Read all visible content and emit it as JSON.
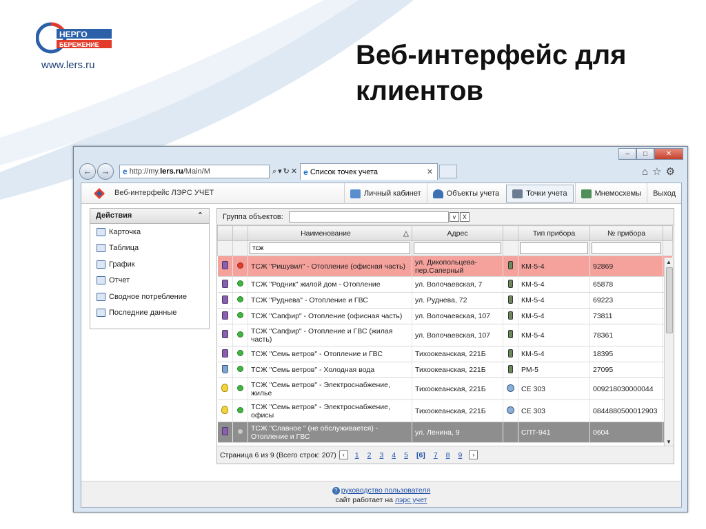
{
  "slide": {
    "title": "Веб-интерфейс для клиентов",
    "site_url": "www.lers.ru",
    "logo_text_top": "НЕРГО",
    "logo_text_bottom": "БЕРЕЖЕНИЕ"
  },
  "browser": {
    "address_prefix": "http://my.",
    "address_domain": "lers.ru",
    "address_suffix": "/Main/M",
    "tab_title": "Список точек учета"
  },
  "app": {
    "title": "Веб-интерфейс ЛЭРС УЧЕТ",
    "nav": [
      {
        "label": "Личный кабинет",
        "icon": "personal-cabinet-icon"
      },
      {
        "label": "Объекты учета",
        "icon": "objects-icon"
      },
      {
        "label": "Точки учета",
        "icon": "metering-points-icon",
        "active": true
      },
      {
        "label": "Мнемосхемы",
        "icon": "mnemonic-icon"
      },
      {
        "label": "Выход"
      }
    ]
  },
  "actions": {
    "header": "Действия",
    "items": [
      {
        "label": "Карточка",
        "icon": "card-icon"
      },
      {
        "label": "Таблица",
        "icon": "table-icon"
      },
      {
        "label": "График",
        "icon": "chart-icon"
      },
      {
        "label": "Отчет",
        "icon": "report-icon"
      },
      {
        "label": "Сводное потребление",
        "icon": "summary-icon"
      },
      {
        "label": "Последние данные",
        "icon": "latest-data-icon"
      }
    ]
  },
  "grid": {
    "group_label": "Группа объектов:",
    "columns": {
      "name": "Наименование",
      "address": "Адрес",
      "device_type": "Тип прибора",
      "device_number": "№ прибора"
    },
    "filter_name": "тсж",
    "rows": [
      {
        "name": "ТСЖ \"Ришувил\" - Отопление (офисная часть)",
        "address": "ул. Дикопольцева-пер.Саперный",
        "type": "КМ-5-4",
        "number": "92869",
        "kind": "heat",
        "status": "red",
        "device": "meter",
        "state": "alert"
      },
      {
        "name": "ТСЖ \"Родник\" жилой дом - Отопление",
        "address": "ул. Волочаевская, 7",
        "type": "КМ-5-4",
        "number": "65878",
        "kind": "heat",
        "status": "green",
        "device": "meter",
        "state": "normal"
      },
      {
        "name": "ТСЖ \"Руднева\" - Отопление и ГВС",
        "address": "ул. Руднева, 72",
        "type": "КМ-5-4",
        "number": "69223",
        "kind": "heat",
        "status": "green",
        "device": "meter",
        "state": "normal"
      },
      {
        "name": "ТСЖ \"Сапфир\" - Отопление (офисная часть)",
        "address": "ул. Волочаевская, 107",
        "type": "КМ-5-4",
        "number": "73811",
        "kind": "heat",
        "status": "green",
        "device": "meter",
        "state": "normal"
      },
      {
        "name": "ТСЖ \"Сапфир\" - Отопление и ГВС (жилая часть)",
        "address": "ул. Волочаевская, 107",
        "type": "КМ-5-4",
        "number": "78361",
        "kind": "heat",
        "status": "green",
        "device": "meter",
        "state": "normal"
      },
      {
        "name": "ТСЖ \"Семь ветров\" - Отопление и ГВС",
        "address": "Тихоокеанская, 221Б",
        "type": "КМ-5-4",
        "number": "18395",
        "kind": "heat",
        "status": "green",
        "device": "meter",
        "state": "normal"
      },
      {
        "name": "ТСЖ \"Семь ветров\" - Холодная вода",
        "address": "Тихоокеанская, 221Б",
        "type": "РМ-5",
        "number": "27095",
        "kind": "water",
        "status": "green",
        "device": "meter",
        "state": "normal"
      },
      {
        "name": "ТСЖ \"Семь ветров\" - Электроснабжение, жилье",
        "address": "Тихоокеанская, 221Б",
        "type": "CE 303",
        "number": "009218030000044",
        "kind": "elec",
        "status": "green",
        "device": "globe",
        "state": "normal"
      },
      {
        "name": "ТСЖ \"Семь ветров\" - Электроснабжение, офисы",
        "address": "Тихоокеанская, 221Б",
        "type": "CE 303",
        "number": "0844880500012903",
        "kind": "elec",
        "status": "green",
        "device": "globe",
        "state": "normal"
      },
      {
        "name": "ТСЖ \"Славное \" (не обслуживается) - Отопление и ГВС",
        "address": "ул. Ленина, 9",
        "type": "СПТ-941",
        "number": "0604",
        "kind": "heat",
        "status": "grey",
        "device": "none",
        "state": "inactive"
      }
    ],
    "pager": {
      "summary": "Страница 6 из 9 (Всего строк: 207)",
      "pages": [
        "1",
        "2",
        "3",
        "4",
        "5",
        "[6]",
        "7",
        "8",
        "9"
      ],
      "current": "[6]"
    }
  },
  "footer": {
    "guide_link": "руководство пользователя",
    "powered_prefix": "сайт работает на",
    "powered_link": "лэрс учет"
  },
  "colors": {
    "alert_row": "#f5a19c",
    "inactive_row": "#8e8e8e",
    "status_green": "#3fb63f",
    "status_red": "#e23b2a",
    "status_grey": "#c8c8c8",
    "link": "#1f4fa8"
  }
}
